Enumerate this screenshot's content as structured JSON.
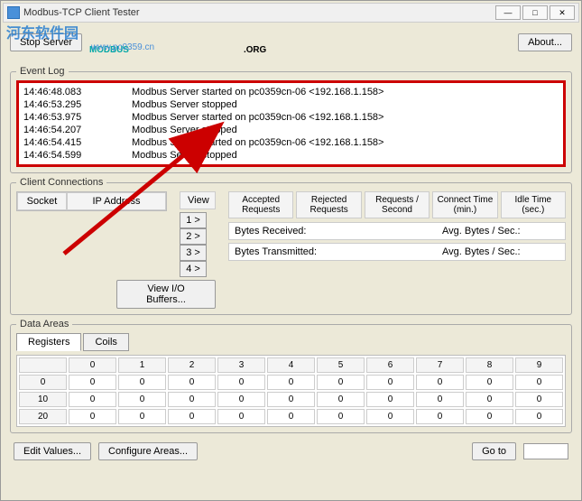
{
  "title": "Modbus-TCP Client Tester",
  "toolbar": {
    "stop": "Stop Server",
    "about": "About..."
  },
  "watermark": {
    "text": "河东软件园",
    "url": "www.pc0359.cn"
  },
  "logo": {
    "left": "MODBUS",
    "right": ".ORG"
  },
  "eventLog": {
    "legend": "Event Log",
    "rows": [
      {
        "time": "14:46:48.083",
        "msg": "Modbus Server started on pc0359cn-06 <192.168.1.158>"
      },
      {
        "time": "14:46:53.295",
        "msg": "Modbus Server stopped"
      },
      {
        "time": "14:46:53.975",
        "msg": "Modbus Server started on pc0359cn-06 <192.168.1.158>"
      },
      {
        "time": "14:46:54.207",
        "msg": "Modbus Server stopped"
      },
      {
        "time": "14:46:54.415",
        "msg": "Modbus Server started on pc0359cn-06 <192.168.1.158>"
      },
      {
        "time": "14:46:54.599",
        "msg": "Modbus Server stopped"
      }
    ]
  },
  "client": {
    "legend": "Client Connections",
    "socket": "Socket",
    "ipaddr": "IP Address",
    "viewHdr": "View",
    "viewBtns": [
      "1 >",
      "2 >",
      "3 >",
      "4 >"
    ],
    "viewBuffers": "View I/O Buffers...",
    "stats": {
      "accepted": "Accepted Requests",
      "rejected": "Rejected Requests",
      "persec": "Requests / Second",
      "connect": "Connect Time (min.)",
      "idle": "Idle Time (sec.)"
    },
    "bytesRx": "Bytes Received:",
    "bytesTx": "Bytes Transmitted:",
    "avg": "Avg. Bytes / Sec.:"
  },
  "dataAreas": {
    "legend": "Data Areas",
    "tabs": [
      "Registers",
      "Coils"
    ],
    "cols": [
      "0",
      "1",
      "2",
      "3",
      "4",
      "5",
      "6",
      "7",
      "8",
      "9"
    ],
    "rows": [
      {
        "h": "0",
        "v": [
          "0",
          "0",
          "0",
          "0",
          "0",
          "0",
          "0",
          "0",
          "0",
          "0"
        ]
      },
      {
        "h": "10",
        "v": [
          "0",
          "0",
          "0",
          "0",
          "0",
          "0",
          "0",
          "0",
          "0",
          "0"
        ]
      },
      {
        "h": "20",
        "v": [
          "0",
          "0",
          "0",
          "0",
          "0",
          "0",
          "0",
          "0",
          "0",
          "0"
        ]
      }
    ]
  },
  "bottom": {
    "edit": "Edit Values...",
    "configure": "Configure Areas...",
    "goto": "Go to"
  }
}
